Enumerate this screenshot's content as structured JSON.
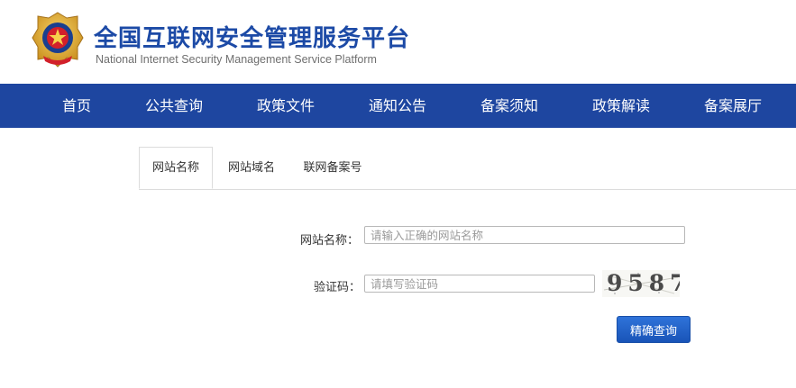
{
  "header": {
    "title": "全国互联网安全管理服务平台",
    "subtitle": "National Internet Security Management Service Platform",
    "emblem_icon": "police-emblem-icon"
  },
  "nav": {
    "items": [
      {
        "label": "首页"
      },
      {
        "label": "公共查询"
      },
      {
        "label": "政策文件"
      },
      {
        "label": "通知公告"
      },
      {
        "label": "备案须知"
      },
      {
        "label": "政策解读"
      },
      {
        "label": "备案展厅"
      }
    ],
    "background": "#1e46a0"
  },
  "tabs": [
    {
      "label": "网站名称",
      "active": true
    },
    {
      "label": "网站域名",
      "active": false
    },
    {
      "label": "联网备案号",
      "active": false
    }
  ],
  "form": {
    "site_name_label": "网站名称：",
    "site_name_placeholder": "请输入正确的网站名称",
    "captcha_label": "验证码：",
    "captcha_placeholder": "请填写验证码",
    "captcha_text": "9587",
    "submit_label": "精确查询"
  },
  "colors": {
    "accent": "#1c4aa6",
    "button": "#1f5ec7"
  }
}
